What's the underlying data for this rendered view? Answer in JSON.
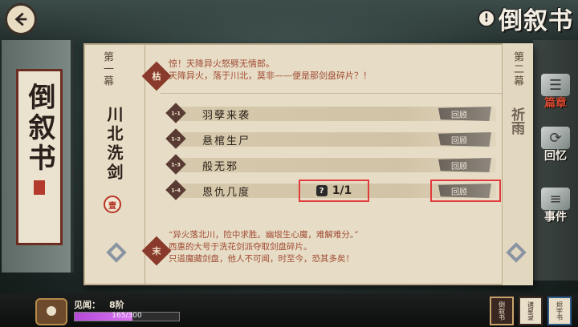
{
  "top_title": "倒叙书",
  "book": {
    "title": "倒叙书"
  },
  "scroll": {
    "act1_label": "第一幕",
    "chapter_name": "川北洗剑",
    "chapter_badge": "壹",
    "intro_stamp": "枯",
    "intro_lines": [
      "惊！天降异火怒劈无情郎。",
      "天降异火，落于川北，莫非——便是那剑盘碎片？！"
    ],
    "missions": [
      {
        "num": "1-1",
        "name": "羽孽来袭",
        "review": "回顾"
      },
      {
        "num": "1-2",
        "name": "悬棺生尸",
        "review": "回顾"
      },
      {
        "num": "1-3",
        "name": "般无邪",
        "review": "回顾"
      },
      {
        "num": "1-4",
        "name": "恩仇几度",
        "review": "回顾",
        "progress": "1/1",
        "progress_icon": "?"
      }
    ],
    "outro_stamp": "末",
    "outro_lines": [
      "“异火落北川，险中求胜。幽垠生心魔，难解难分。”",
      "西惠的大号于洗花剑派夺取剑盘碎片。",
      "只道魔藏剑盘，他人不可闻，时至今，恐其多矣！"
    ],
    "act2_label": "第二幕",
    "act2_chapter": "祈雨"
  },
  "side_menu": [
    {
      "icon": "book-icon",
      "label": "篇章",
      "active": true
    },
    {
      "icon": "swirl-icon",
      "label": "回忆",
      "active": false
    },
    {
      "icon": "scroll-icon",
      "label": "事件",
      "active": false
    }
  ],
  "bottom": {
    "exp_label": "见闻：",
    "exp_level": "8阶",
    "exp_current": 165,
    "exp_max": 300,
    "exp_text": "165/300",
    "tiles": [
      "倒叙书",
      "诸星录",
      "烬宇书"
    ]
  }
}
